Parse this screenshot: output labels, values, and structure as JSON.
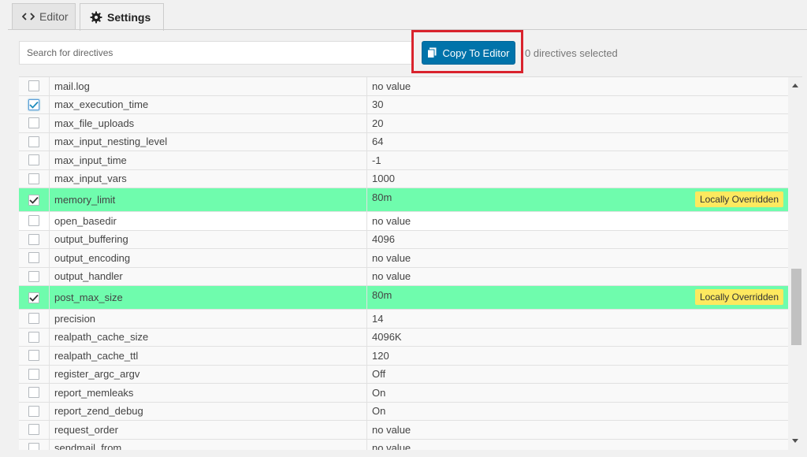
{
  "tabs": [
    {
      "label": "Editor",
      "icon": "code-icon"
    },
    {
      "label": "Settings",
      "icon": "gear-icon"
    }
  ],
  "search": {
    "placeholder": "Search for directives",
    "value": ""
  },
  "toolbar": {
    "copy_label": "Copy To Editor",
    "selected_text": "0 directives selected"
  },
  "badge_label": "Locally Overridden",
  "colors": {
    "override_row": "#6ffcad",
    "badge": "#fde95f",
    "primary_button": "#0073aa",
    "highlight_box": "#d9232d"
  },
  "rows": [
    {
      "name": "mail.log",
      "value": "no value",
      "checked": false,
      "override": false
    },
    {
      "name": "max_execution_time",
      "value": "30",
      "checked": true,
      "override": false
    },
    {
      "name": "max_file_uploads",
      "value": "20",
      "checked": false,
      "override": false
    },
    {
      "name": "max_input_nesting_level",
      "value": "64",
      "checked": false,
      "override": false
    },
    {
      "name": "max_input_time",
      "value": "-1",
      "checked": false,
      "override": false
    },
    {
      "name": "max_input_vars",
      "value": "1000",
      "checked": false,
      "override": false
    },
    {
      "name": "memory_limit",
      "value": "80m",
      "checked": true,
      "override": true
    },
    {
      "name": "open_basedir",
      "value": "no value",
      "checked": false,
      "override": false
    },
    {
      "name": "output_buffering",
      "value": "4096",
      "checked": false,
      "override": false
    },
    {
      "name": "output_encoding",
      "value": "no value",
      "checked": false,
      "override": false
    },
    {
      "name": "output_handler",
      "value": "no value",
      "checked": false,
      "override": false
    },
    {
      "name": "post_max_size",
      "value": "80m",
      "checked": true,
      "override": true
    },
    {
      "name": "precision",
      "value": "14",
      "checked": false,
      "override": false
    },
    {
      "name": "realpath_cache_size",
      "value": "4096K",
      "checked": false,
      "override": false
    },
    {
      "name": "realpath_cache_ttl",
      "value": "120",
      "checked": false,
      "override": false
    },
    {
      "name": "register_argc_argv",
      "value": "Off",
      "checked": false,
      "override": false
    },
    {
      "name": "report_memleaks",
      "value": "On",
      "checked": false,
      "override": false
    },
    {
      "name": "report_zend_debug",
      "value": "On",
      "checked": false,
      "override": false
    },
    {
      "name": "request_order",
      "value": "no value",
      "checked": false,
      "override": false
    },
    {
      "name": "sendmail_from",
      "value": "no value",
      "checked": false,
      "override": false
    }
  ]
}
